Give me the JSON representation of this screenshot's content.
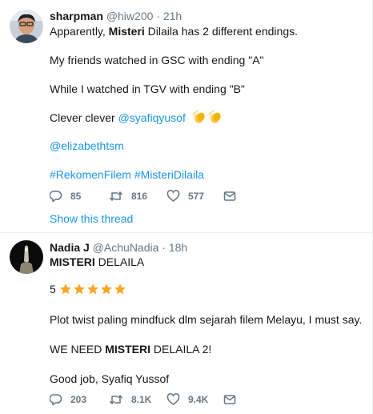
{
  "tweets": [
    {
      "name": "sharpman",
      "handle": "@hiw200",
      "sep": "·",
      "time": "21h",
      "intro_prefix": "Apparently, ",
      "intro_bold": "Misteri",
      "intro_suffix": " Dilaila has 2 different endings.",
      "line_gsc": "My friends watched in GSC with ending \"A\"",
      "line_tgv": "While I watched in TGV with ending \"B\"",
      "clever_prefix": "Clever clever ",
      "clever_mention": "@syafiqyusof",
      "mention2": "@elizabethtsm",
      "hashtag1": "#RekomenFilem",
      "hashtag2": "#MisteriDilaila",
      "replies": "85",
      "retweets": "816",
      "likes": "577",
      "show_thread": "Show this thread"
    },
    {
      "name": "Nadia J",
      "handle": "@AchuNadia",
      "sep": "·",
      "time": "18h",
      "title_bold": "MISTERI",
      "title_rest": " DELAILA",
      "rating_num": "5",
      "stars": 5,
      "plot_line": "Plot twist paling mindfuck dlm sejarah filem Melayu, I must say.",
      "need_prefix": "WE NEED ",
      "need_bold": "MISTERI",
      "need_suffix": " DELAILA 2!",
      "good_job": "Good job, Syafiq Yussof",
      "replies": "203",
      "retweets": "8.1K",
      "likes": "9.4K"
    }
  ],
  "colors": {
    "link": "#1b95e0",
    "muted": "#657786",
    "star": "#f5a623",
    "divider": "#e6ecf0"
  },
  "icons": [
    "reply-icon",
    "retweet-icon",
    "like-icon",
    "message-icon",
    "clapping-hands-icon",
    "star-icon"
  ]
}
